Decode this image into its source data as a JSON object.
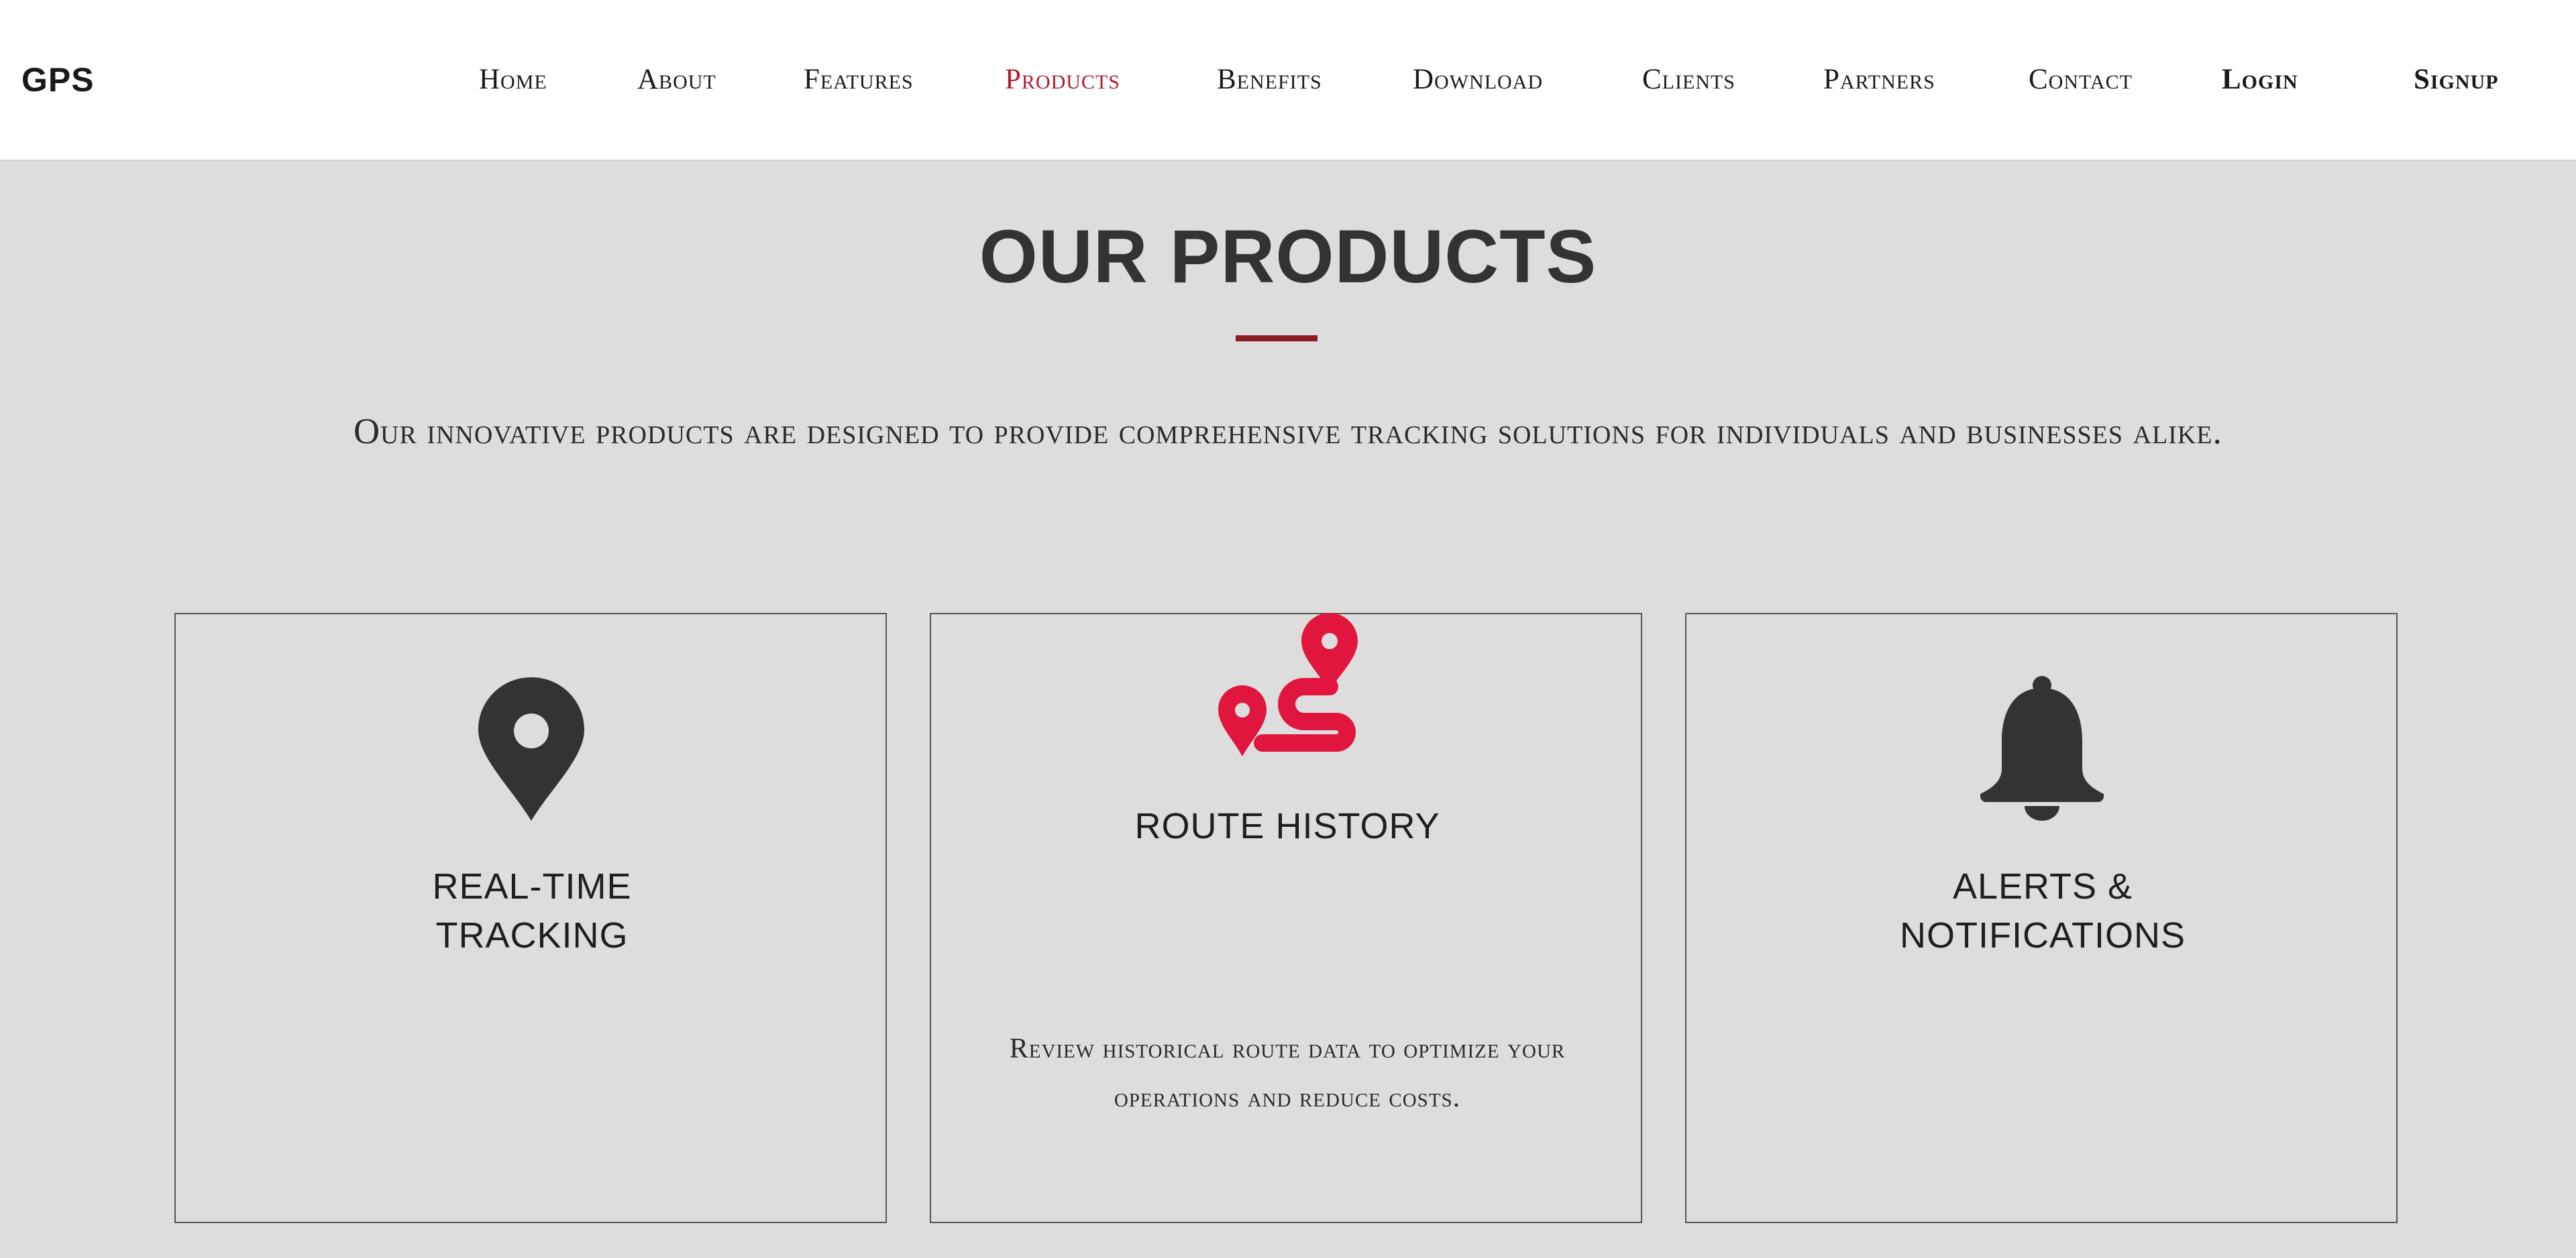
{
  "header": {
    "logo": "GPS",
    "nav": [
      "Home",
      "About",
      "Features",
      "Products",
      "Benefits",
      "Download",
      "Clients",
      "Partners",
      "Contact"
    ],
    "active_item": "Products",
    "login": "Login",
    "signup": "Signup"
  },
  "section": {
    "title": "OUR PRODUCTS",
    "subtitle": "Our innovative products are designed to provide comprehensive tracking solutions for individuals and businesses alike."
  },
  "cards": [
    {
      "icon": "map-pin-icon",
      "title_lines": [
        "REAL-TIME",
        "TRACKING"
      ],
      "description": ""
    },
    {
      "icon": "route-icon",
      "title": "ROUTE HISTORY",
      "description_lines": [
        "Review historical route data to optimize your",
        "operations and reduce costs."
      ]
    },
    {
      "icon": "bell-icon",
      "title_lines": [
        "ALERTS &",
        "NOTIFICATIONS"
      ],
      "description": ""
    }
  ],
  "colors": {
    "accent": "#b01c2e",
    "route_icon": "#e0163f",
    "underline": "#8b1a24",
    "background": "#dddddd",
    "header_bg": "#ffffff",
    "icon_dark": "#333333"
  }
}
